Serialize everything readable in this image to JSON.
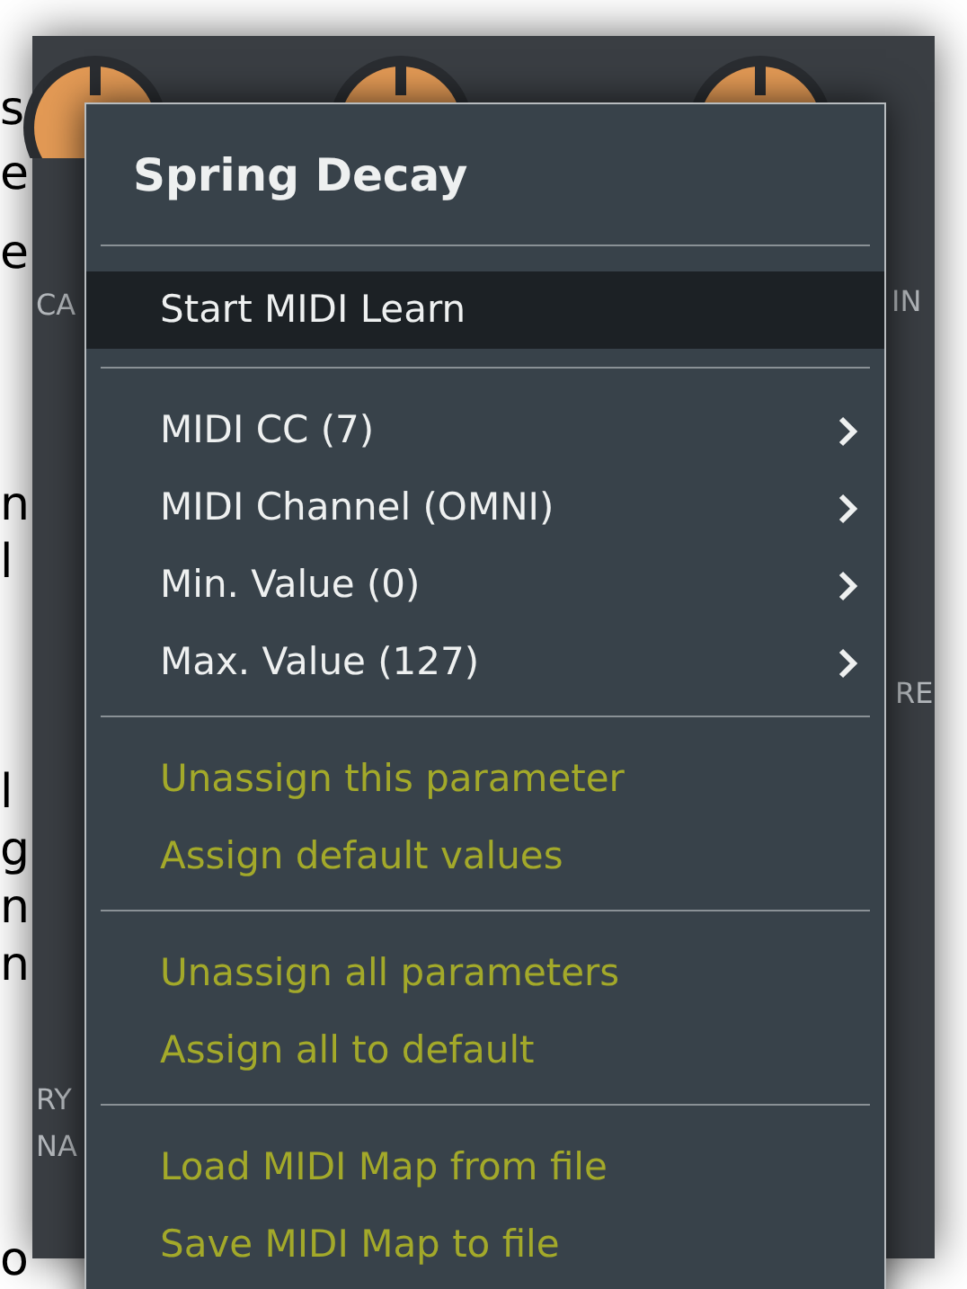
{
  "page_margin_letters": [
    "s",
    "e",
    "e",
    "n",
    "l",
    "l",
    "g",
    "n",
    "n",
    "o"
  ],
  "plugin_labels": [
    "CA",
    "IN",
    "RE",
    "RY",
    "NA"
  ],
  "menu": {
    "title": "Spring Decay",
    "sections": [
      [
        {
          "label": "Start MIDI Learn",
          "kind": "action",
          "selected": true
        }
      ],
      [
        {
          "label": "MIDI CC (7)",
          "kind": "submenu",
          "selected": false
        },
        {
          "label": "MIDI Channel (OMNI)",
          "kind": "submenu",
          "selected": false
        },
        {
          "label": "Min. Value (0)",
          "kind": "submenu",
          "selected": false
        },
        {
          "label": "Max. Value (127)",
          "kind": "submenu",
          "selected": false
        }
      ],
      [
        {
          "label": "Unassign this parameter",
          "kind": "option",
          "selected": false
        },
        {
          "label": "Assign default values",
          "kind": "option",
          "selected": false
        }
      ],
      [
        {
          "label": "Unassign all parameters",
          "kind": "option",
          "selected": false
        },
        {
          "label": "Assign all to default",
          "kind": "option",
          "selected": false
        }
      ],
      [
        {
          "label": "Load MIDI Map from file",
          "kind": "option",
          "selected": false
        },
        {
          "label": "Save MIDI Map to file",
          "kind": "option",
          "selected": false
        }
      ]
    ]
  }
}
